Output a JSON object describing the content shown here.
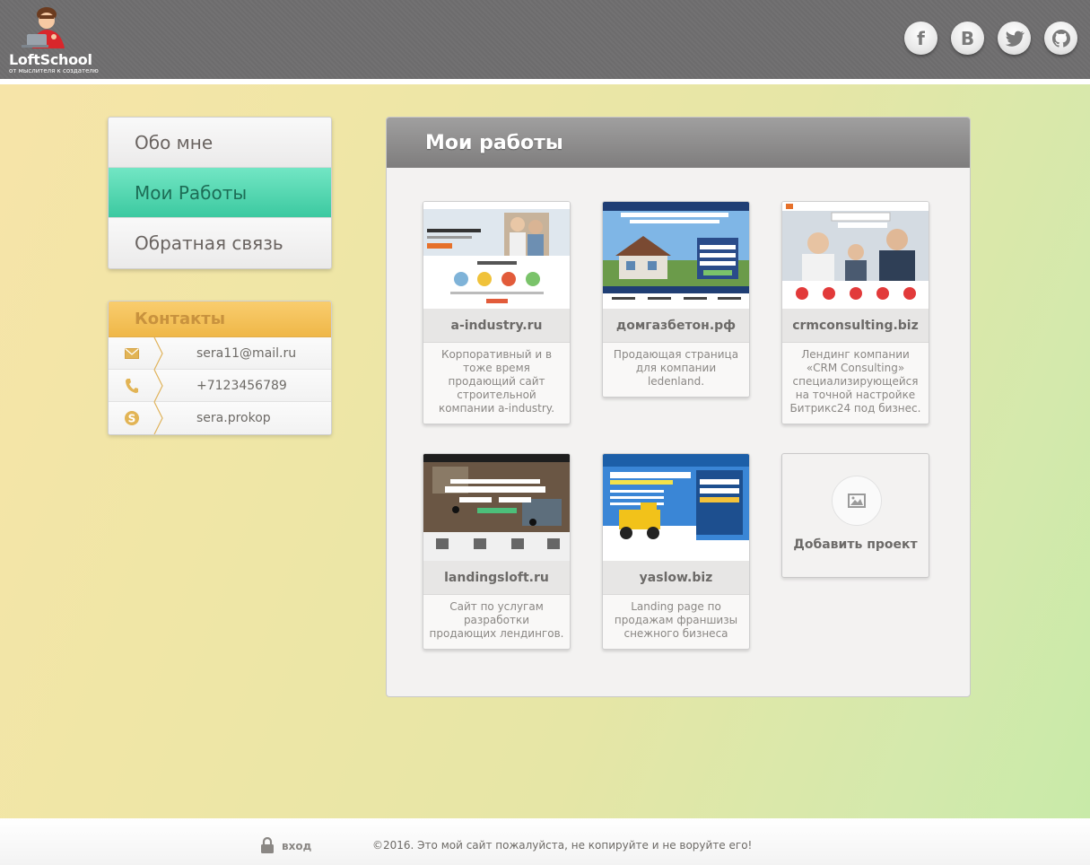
{
  "header": {
    "logo_title": "LoftSchool",
    "logo_subtitle": "от мыслителя к создателю",
    "social": [
      {
        "icon": "facebook-icon",
        "glyph": "f"
      },
      {
        "icon": "vk-icon",
        "glyph": "B"
      },
      {
        "icon": "twitter-icon",
        "glyph": "t"
      },
      {
        "icon": "github-icon",
        "glyph": "g"
      }
    ]
  },
  "menu": {
    "items": [
      {
        "label": "Обо мне",
        "active": false
      },
      {
        "label": "Мои Работы",
        "active": true
      },
      {
        "label": "Обратная связь",
        "active": false
      }
    ]
  },
  "contacts": {
    "title": "Контакты",
    "items": [
      {
        "icon": "mail-icon",
        "value": "sera11@mail.ru"
      },
      {
        "icon": "phone-icon",
        "value": "+7123456789"
      },
      {
        "icon": "skype-icon",
        "value": "sera.prokop"
      }
    ]
  },
  "works": {
    "title": "Мои работы",
    "projects": [
      {
        "title": "a-industry.ru",
        "description": "Корпоративный и в тоже время продающий сайт строительной компании a-industry."
      },
      {
        "title": "домгазбетон.рф",
        "description": "Продающая страница для компании ledenland."
      },
      {
        "title": "crmconsulting.biz",
        "description": "Лендинг компании «CRM Consulting» специализирующейся на точной настройке Битрикс24 под бизнес."
      },
      {
        "title": "landingsloft.ru",
        "description": "Сайт по услугам разработки продающих лендингов."
      },
      {
        "title": "yaslow.biz",
        "description": "Landing page по продажам франшизы снежного бизнеса"
      }
    ],
    "add_label": "Добавить проект"
  },
  "footer": {
    "login_label": "вход",
    "copyright": "©2016. Это мой сайт пожалуйста, не копируйте и не воруйте его!"
  },
  "colors": {
    "accent": "#3cc9a0",
    "contacts": "#efb748",
    "header": "#6d6c6d"
  }
}
